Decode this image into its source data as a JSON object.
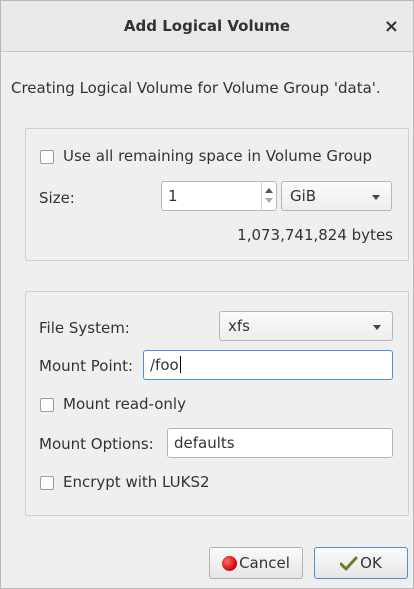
{
  "window": {
    "title": "Add Logical Volume",
    "close_glyph": "×"
  },
  "intro_text": "Creating Logical Volume for Volume Group 'data'.",
  "size_section": {
    "use_all_label": "Use all remaining space in Volume Group",
    "use_all_checked": false,
    "size_label": "Size:",
    "size_value": "1",
    "unit_value": "GiB",
    "bytes_text": "1,073,741,824 bytes"
  },
  "fs_section": {
    "fs_label": "File System:",
    "fs_value": "xfs",
    "mount_point_label": "Mount Point:",
    "mount_point_value": "/foo",
    "read_only_label": "Mount read-only",
    "read_only_checked": false,
    "mount_options_label": "Mount Options:",
    "mount_options_value": "defaults",
    "encrypt_label": "Encrypt with LUKS2",
    "encrypt_checked": false
  },
  "buttons": {
    "cancel_label": "Cancel",
    "cancel_icon": "stop-icon",
    "ok_label": "OK",
    "ok_icon": "ok-icon"
  },
  "colors": {
    "accent": "#4a90d9",
    "cancel_icon": "#cc0000"
  }
}
